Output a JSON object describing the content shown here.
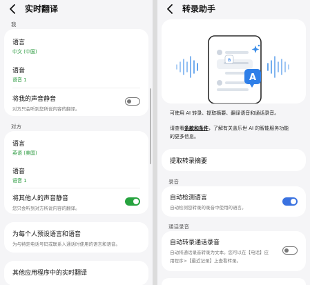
{
  "left": {
    "title": "实时翻译",
    "section_me": "我",
    "me_language_title": "语言",
    "me_language_value": "中文 (中国)",
    "me_voice_title": "语音",
    "me_voice_value": "语音 1",
    "mute_me_title": "将我的声音静音",
    "mute_me_desc": "对方只会听到您所说内容的翻译。",
    "section_other": "对方",
    "other_language_title": "语言",
    "other_language_value": "英语 (美国)",
    "other_voice_title": "语音",
    "other_voice_value": "语音 1",
    "mute_other_title": "将其他人的声音静音",
    "mute_other_desc": "您只会听到对方所说内容的翻译。",
    "preset_title": "为每个人预设语言和语音",
    "preset_desc": "为与特定电话号码或联系人通话时使用的语言和语音。",
    "other_apps_title": "其他应用程序中的实时翻译"
  },
  "right": {
    "title": "转录助手",
    "intro_line1": "可使用 AI 转录、提取摘要、翻译语音和通话录音。",
    "terms_prefix": "请查看",
    "terms_link": "条款和条件",
    "terms_suffix": "，了解有关盖乐世 AI 的智能服务功能",
    "terms_line2": "的更多信息。",
    "extract_summary": "提取转录摘要",
    "section_recording": "录音",
    "auto_detect_title": "自动检测语言",
    "auto_detect_desc": "自动检测您转录的录音中使用的语言。",
    "section_call": "通话录音",
    "auto_transcribe_title": "自动转录通话录音",
    "auto_transcribe_desc1": "自动将通话录音转录为文本。您可以在【电话】应",
    "auto_transcribe_desc2": "用程序>【最近记录】上查看转录。",
    "illustration_glyph_small": "a",
    "illustration_glyph_large": "A"
  },
  "colors": {
    "accent_green": "#27a33f",
    "accent_blue": "#3a72e0",
    "illustration_blue": "#2f7fe8"
  },
  "toggles": {
    "mute_me": false,
    "mute_other": true,
    "auto_detect": true,
    "auto_transcribe": false
  }
}
